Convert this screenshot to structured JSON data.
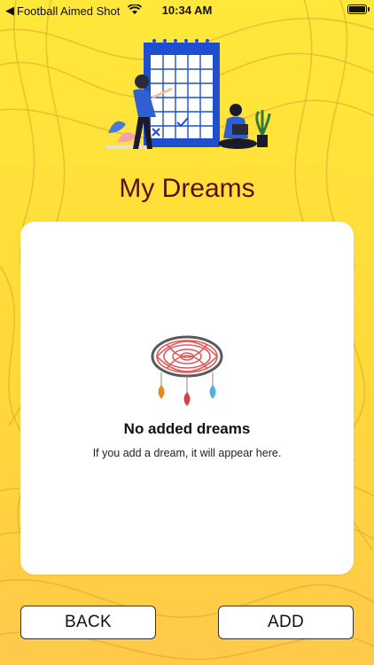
{
  "status_bar": {
    "back_app": "Football Aimed Shot",
    "time": "10:34 AM"
  },
  "page": {
    "title": "My Dreams"
  },
  "empty_state": {
    "icon": "dreamcatcher-icon",
    "title": "No added dreams",
    "subtitle": "If you add a dream, it will appear here."
  },
  "actions": {
    "back_label": "BACK",
    "add_label": "ADD"
  },
  "colors": {
    "background": "#ffe83a",
    "title": "#5a1010",
    "calendar": "#1e4fd0",
    "dreamcatcher_ring": "#e05a5a"
  }
}
